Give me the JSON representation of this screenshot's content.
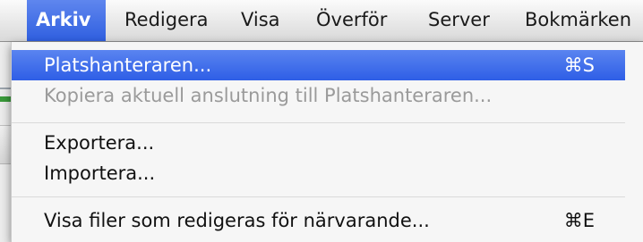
{
  "menubar": {
    "items": [
      {
        "label": "Arkiv"
      },
      {
        "label": "Redigera"
      },
      {
        "label": "Visa"
      },
      {
        "label": "Överför"
      },
      {
        "label": "Server"
      },
      {
        "label": "Bokmärken"
      }
    ]
  },
  "dropdown": {
    "items": [
      {
        "label": "Platshanteraren...",
        "shortcut": "⌘S"
      },
      {
        "label": "Kopiera aktuell anslutning till Platshanteraren..."
      },
      {
        "label": "Exportera..."
      },
      {
        "label": "Importera..."
      },
      {
        "label": "Visa filer som redigeras för närvarande...",
        "shortcut": "⌘E"
      }
    ]
  },
  "colors": {
    "highlight": "#2f5fe0",
    "disabled_text": "#9a9a9a"
  }
}
